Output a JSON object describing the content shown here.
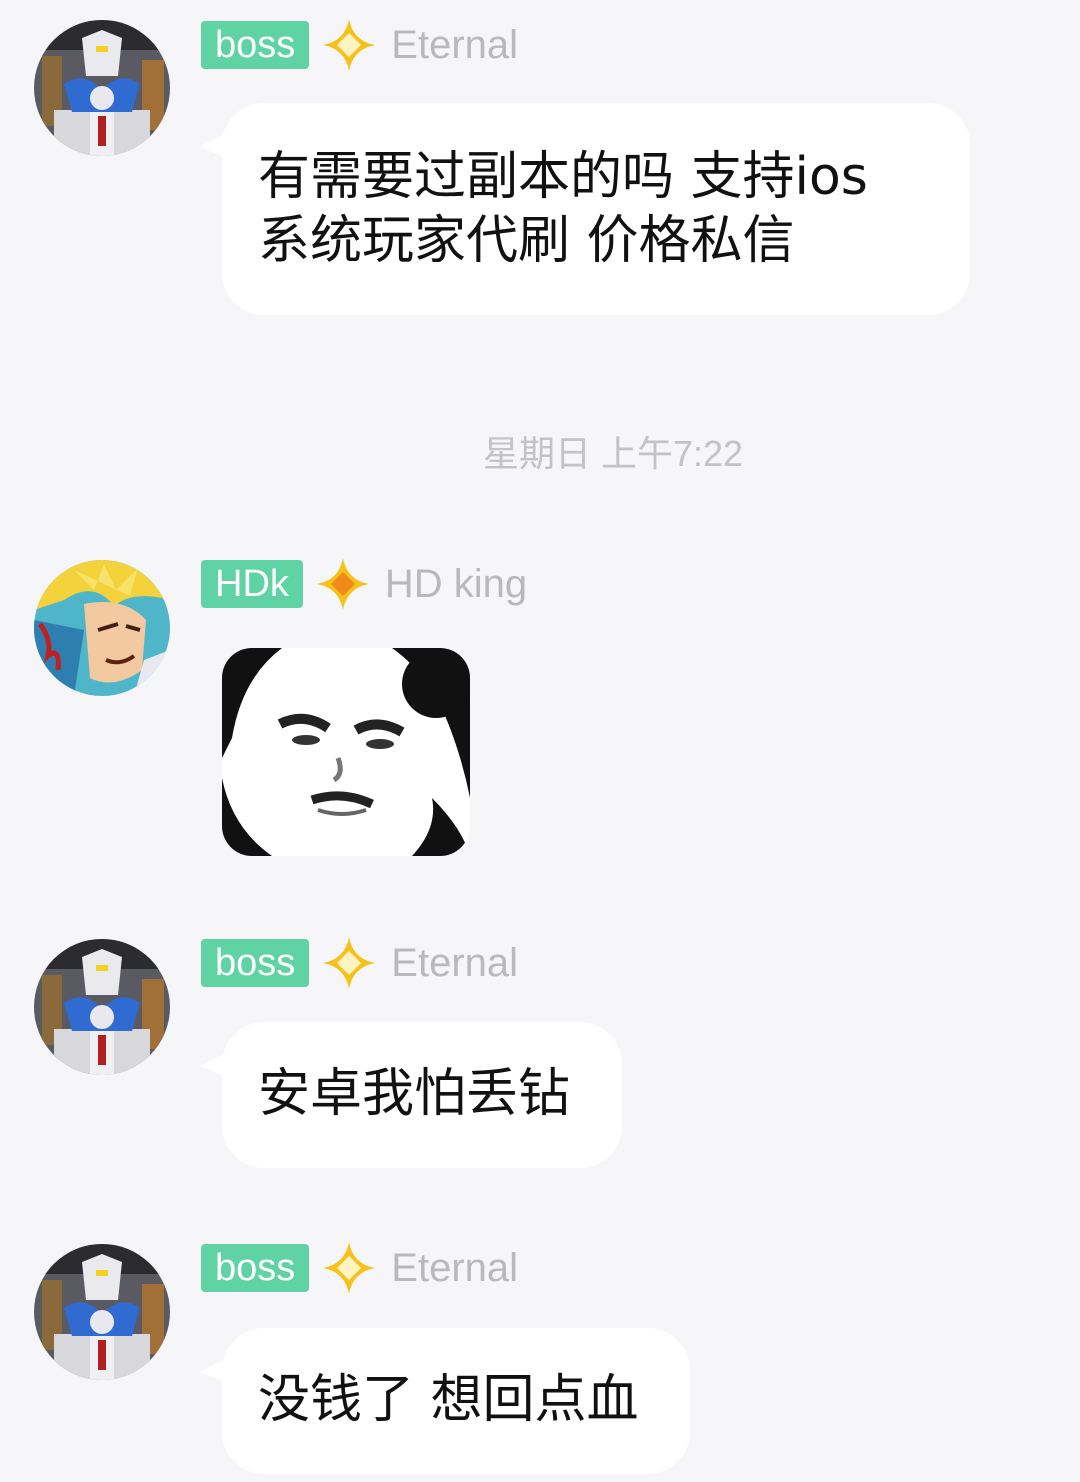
{
  "colors": {
    "background": "#f6f6f9",
    "tag_green": "#5fd3a3",
    "star_yellow": "#f6c21a",
    "nick_gray": "#b9b9bd",
    "timestamp_gray": "#c3c3c7"
  },
  "messages": [
    {
      "tag": "boss",
      "nickname": "Eternal",
      "text": "有需要过副本的吗 支持ios\n系统玩家代刷 价格私信",
      "avatar_icon": "armored-figure-avatar"
    },
    {
      "tag": "HDk",
      "nickname": "HD king",
      "sticker_icon": "panda-face-meme-sticker",
      "avatar_icon": "anime-character-avatar"
    },
    {
      "tag": "boss",
      "nickname": "Eternal",
      "text": "安卓我怕丢钻",
      "avatar_icon": "armored-figure-avatar"
    },
    {
      "tag": "boss",
      "nickname": "Eternal",
      "text": "没钱了 想回点血",
      "avatar_icon": "armored-figure-avatar"
    }
  ],
  "timestamp": "星期日 上午7:22"
}
